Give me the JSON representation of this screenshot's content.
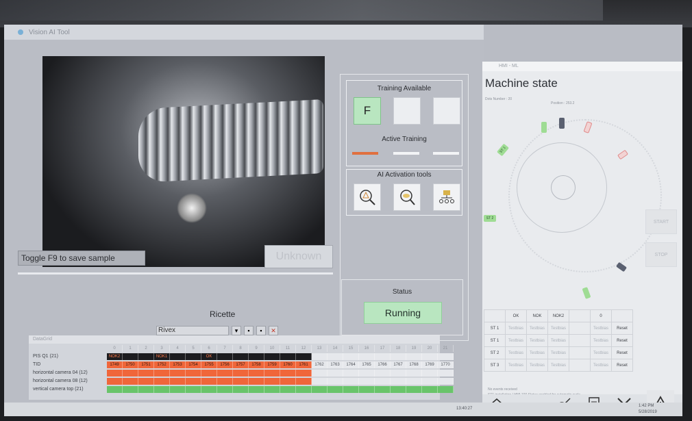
{
  "left_app": {
    "window_title": "Vision AI Tool",
    "toggle_hint": "Toggle F9 to save sample",
    "result_label": "Unknown",
    "ricette": {
      "label": "Ricette",
      "selected": "Rivex"
    },
    "training": {
      "available_title": "Training Available",
      "slots": [
        "F",
        "",
        ""
      ],
      "active_title": "Active Training",
      "bar_colors": [
        "#e0703f",
        "#f3f4f6",
        "#f3f4f6"
      ]
    },
    "ai_tools": {
      "title": "AI Activation tools",
      "icons": [
        "alert-search-icon",
        "magnify-focus-icon",
        "network-tree-icon"
      ]
    },
    "status": {
      "title": "Status",
      "value": "Running"
    }
  },
  "grid": {
    "title": "DataGrid",
    "col_headers": [
      "0",
      "1",
      "2",
      "3",
      "4",
      "5",
      "6",
      "7",
      "8",
      "9",
      "10",
      "11",
      "12",
      "13",
      "14",
      "15",
      "16",
      "17",
      "18",
      "19",
      "20",
      "21"
    ],
    "rows": [
      {
        "label": "PIS Q1 (21)",
        "cells": [
          "NOK2",
          "",
          "",
          "NOK1",
          "",
          "",
          "OK",
          "",
          "",
          "",
          "",
          "",
          "",
          "",
          "",
          "",
          "",
          "",
          "",
          "",
          "",
          ""
        ],
        "color": "#1c1c1f",
        "text_color": "#ff7a4a"
      },
      {
        "label": "TID",
        "cells": [
          "1749",
          "1750",
          "1751",
          "1752",
          "1753",
          "1754",
          "1755",
          "1756",
          "1757",
          "1758",
          "1759",
          "1760",
          "1761",
          "1762",
          "1763",
          "1764",
          "1765",
          "1766",
          "1767",
          "1768",
          "1769",
          "1770"
        ],
        "color": "#f0663a",
        "text_color": "#2a1a14"
      },
      {
        "label": "horizontal camera 04 (12)",
        "cells": [],
        "color": "#f0663a",
        "text_color": "#2a1a14"
      },
      {
        "label": "horizontal camera 08 (12)",
        "cells": [],
        "color": "#f0663a",
        "text_color": "#2a1a14"
      },
      {
        "label": "vertical camera top (21)",
        "cells": [],
        "color": "#69c46a",
        "text_color": "#1c3a1c"
      }
    ],
    "highlight_counts": [
      13,
      13,
      13,
      13,
      22
    ]
  },
  "hmi": {
    "bar_text": "HMI - ML",
    "title": "Machine state",
    "dots_label": "Dots Number : 20",
    "position_label": "Position : 253.2",
    "stations": [
      "ST 1",
      "ST 2"
    ],
    "side_buttons": [
      "START",
      "STOP"
    ],
    "table": {
      "headers": [
        "",
        "OK",
        "NOK",
        "NOK2",
        "",
        "0",
        ""
      ],
      "rows": [
        [
          "ST 1",
          "Testbias",
          "Testbias",
          "Testbias",
          "",
          "Testbias",
          "Reset"
        ],
        [
          "ST 1",
          "Testbias",
          "Testbias",
          "Testbias",
          "",
          "Testbias",
          "Reset"
        ],
        [
          "ST 2",
          "Testbias",
          "Testbias",
          "Testbias",
          "",
          "Testbias",
          "Reset"
        ],
        [
          "ST 3",
          "Testbias",
          "Testbias",
          "Testbias",
          "",
          "Testbias",
          "Reset"
        ]
      ]
    },
    "events": "No events received",
    "footer_note": "ST1 installation / HMI 100 Status enabled for automatic cycle",
    "footer_icons": [
      "home-icon",
      "machine-icon",
      "document-icon",
      "tools-icon",
      "warning-icon"
    ]
  },
  "taskbar": {
    "time": "1:42 PM",
    "date": "5/28/2019",
    "clock_left": "13:40:27"
  }
}
